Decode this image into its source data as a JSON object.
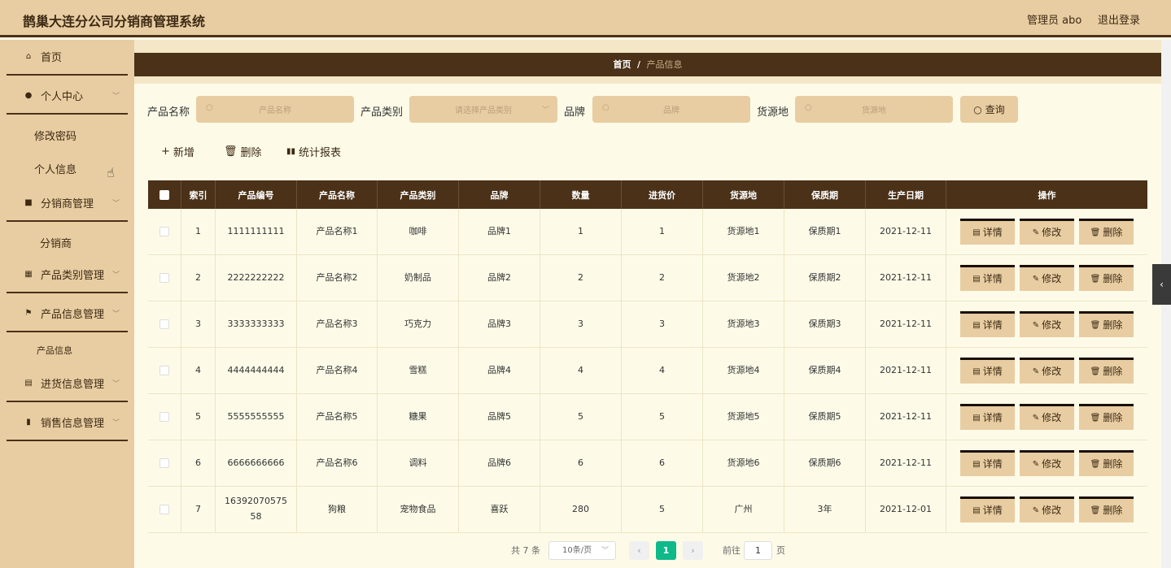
{
  "header": {
    "title": "鹊巢大连分公司分销商管理系统",
    "user": "管理员 abo",
    "logout": "退出登录"
  },
  "sidebar": {
    "home": "首页",
    "personal": "个人中心",
    "change_password": "修改密码",
    "personal_info": "个人信息",
    "distributor_mgmt": "分销商管理",
    "distributor": "分销商",
    "category_mgmt": "产品类别管理",
    "product_mgmt": "产品信息管理",
    "product_info": "产品信息",
    "purchase_mgmt": "进货信息管理",
    "sales_mgmt": "销售信息管理"
  },
  "breadcrumb": {
    "home": "首页",
    "sep": "/",
    "current": "产品信息"
  },
  "filters": {
    "name_label": "产品名称",
    "name_placeholder": "产品名称",
    "category_label": "产品类别",
    "category_placeholder": "请选择产品类别",
    "brand_label": "品牌",
    "brand_placeholder": "品牌",
    "origin_label": "货源地",
    "origin_placeholder": "货源地",
    "query": "查询"
  },
  "toolbar": {
    "add": "新增",
    "delete": "删除",
    "report": "统计报表"
  },
  "table": {
    "headers": [
      "索引",
      "产品编号",
      "产品名称",
      "产品类别",
      "品牌",
      "数量",
      "进货价",
      "货源地",
      "保质期",
      "生产日期",
      "操作"
    ],
    "rows": [
      [
        "1",
        "1111111111",
        "产品名称1",
        "咖啡",
        "品牌1",
        "1",
        "1",
        "货源地1",
        "保质期1",
        "2021-12-11"
      ],
      [
        "2",
        "2222222222",
        "产品名称2",
        "奶制品",
        "品牌2",
        "2",
        "2",
        "货源地2",
        "保质期2",
        "2021-12-11"
      ],
      [
        "3",
        "3333333333",
        "产品名称3",
        "巧克力",
        "品牌3",
        "3",
        "3",
        "货源地3",
        "保质期3",
        "2021-12-11"
      ],
      [
        "4",
        "4444444444",
        "产品名称4",
        "雪糕",
        "品牌4",
        "4",
        "4",
        "货源地4",
        "保质期4",
        "2021-12-11"
      ],
      [
        "5",
        "5555555555",
        "产品名称5",
        "糖果",
        "品牌5",
        "5",
        "5",
        "货源地5",
        "保质期5",
        "2021-12-11"
      ],
      [
        "6",
        "6666666666",
        "产品名称6",
        "调料",
        "品牌6",
        "6",
        "6",
        "货源地6",
        "保质期6",
        "2021-12-11"
      ],
      [
        "7",
        "1639207057558",
        "狗粮",
        "宠物食品",
        "喜跃",
        "280",
        "5",
        "广州",
        "3年",
        "2021-12-01"
      ]
    ],
    "actions": {
      "detail": "详情",
      "edit": "修改",
      "delete": "删除"
    }
  },
  "pagination": {
    "total": "共 7 条",
    "page_size": "10条/页",
    "current": "1",
    "goto_label": "前往",
    "goto_value": "1",
    "page_suffix": "页"
  },
  "colors": {
    "primary": "#4a3118",
    "accent": "#e8cda2",
    "background": "#fdfbe8",
    "active_page": "#0eb98a"
  }
}
